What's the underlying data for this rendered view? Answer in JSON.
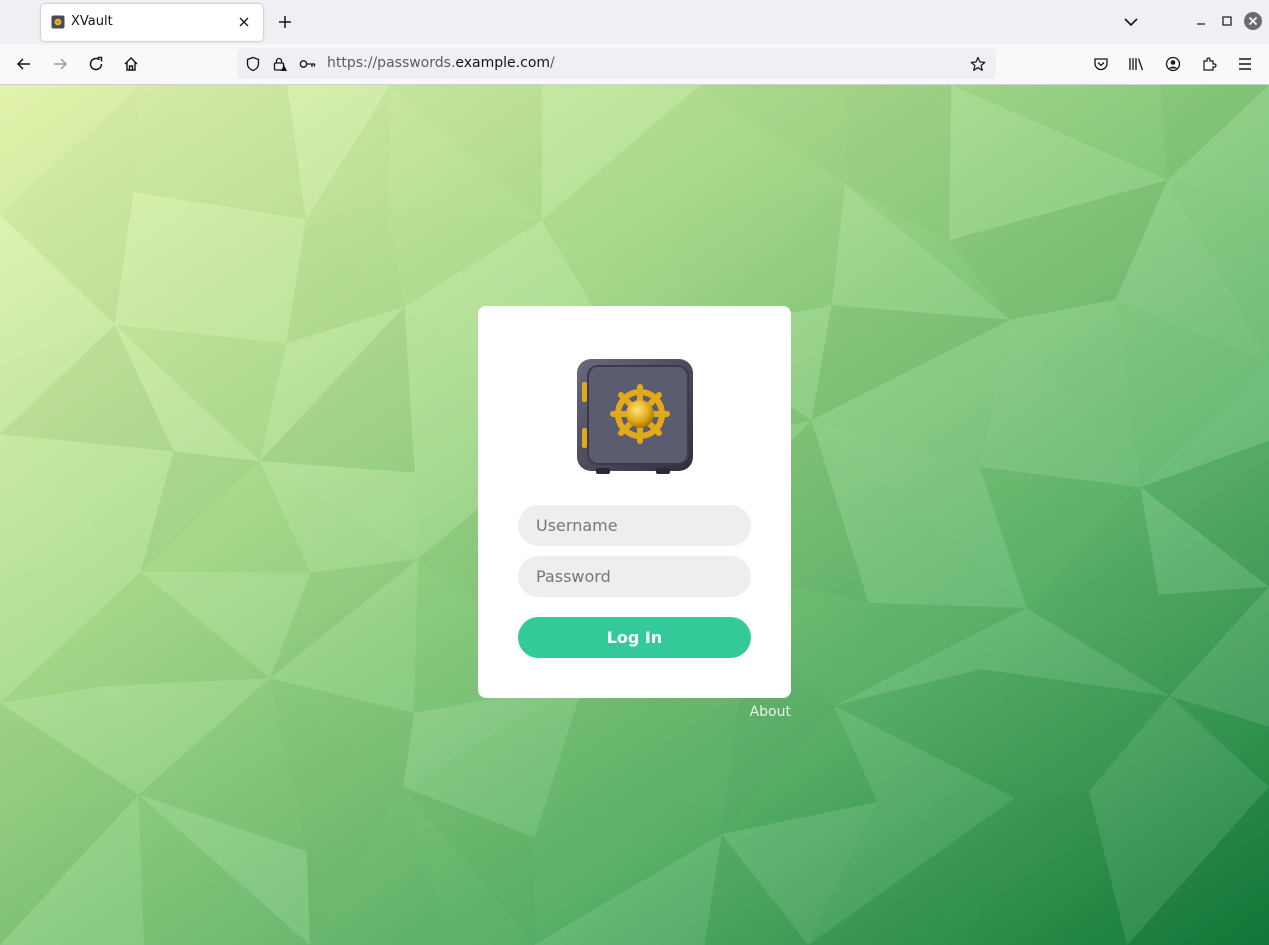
{
  "browser": {
    "tab": {
      "title": "XVault",
      "favicon": "safe-favicon"
    },
    "url": {
      "prefix": "https://passwords.",
      "domain": "example.com",
      "suffix": "/"
    },
    "icons": [
      "back-icon",
      "forward-icon",
      "reload-icon",
      "home-icon",
      "shield-icon",
      "lock-warning-icon",
      "key-icon",
      "star-icon",
      "pocket-icon",
      "library-icon",
      "account-icon",
      "extensions-icon",
      "menu-icon"
    ]
  },
  "login": {
    "username_placeholder": "Username",
    "password_placeholder": "Password",
    "submit_label": "Log In",
    "about_label": "About",
    "logo": "safe-logo"
  },
  "colors": {
    "accent": "#33c998",
    "background_light": "#e8f7b0",
    "background_dark": "#127a3a"
  }
}
